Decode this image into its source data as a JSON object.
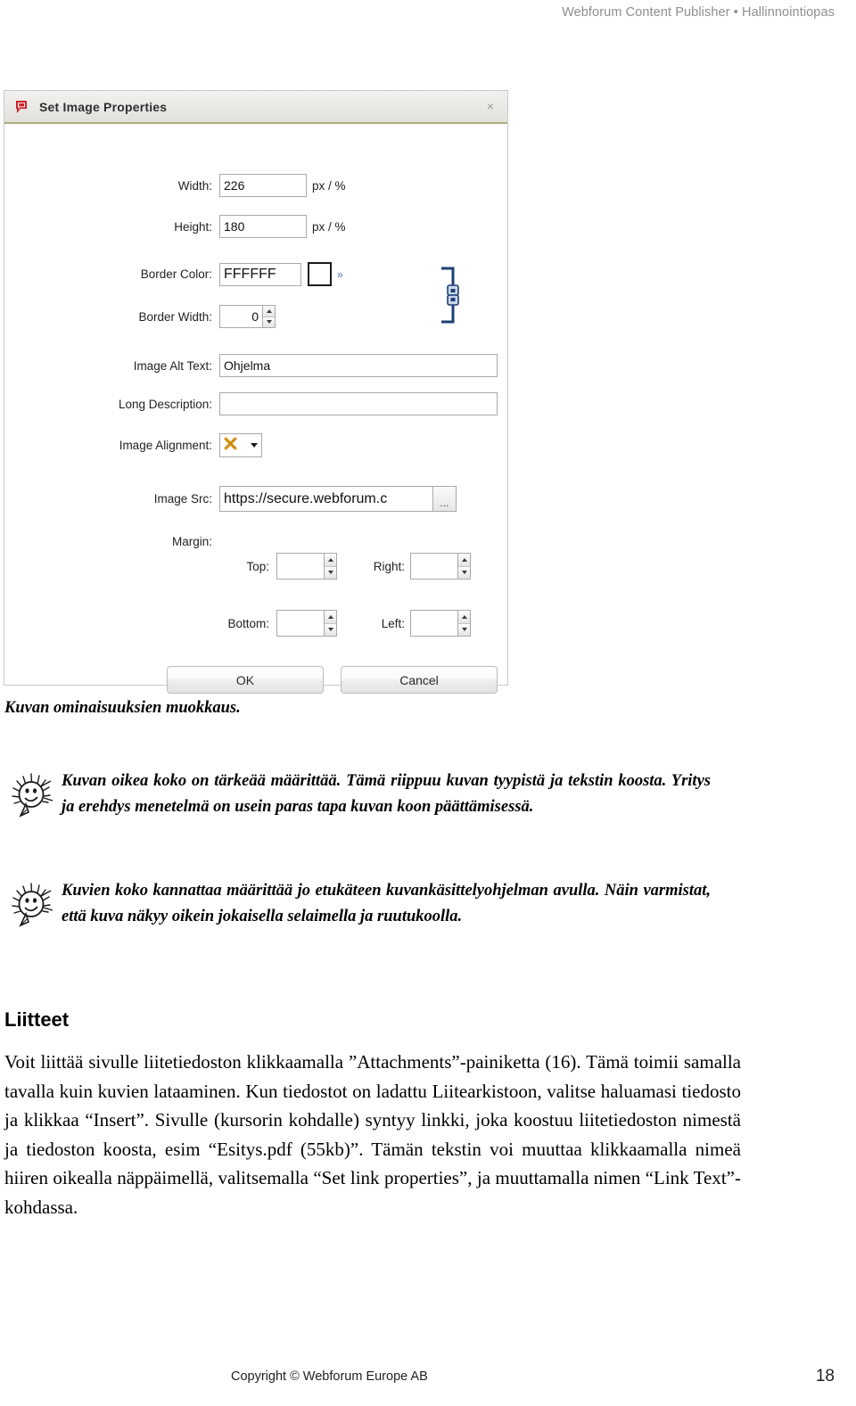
{
  "header": {
    "running_head": "Webforum Content Publisher • Hallinnointiopas"
  },
  "dialog": {
    "title": "Set Image Properties",
    "app_icon": "webforum-logo-icon",
    "close_label": "×",
    "constrain_icon": "constrain-proportions-chain-icon",
    "fields": {
      "width": {
        "label": "Width:",
        "value": "226",
        "suffix": "px / %"
      },
      "height": {
        "label": "Height:",
        "value": "180",
        "suffix": "px / %"
      },
      "border_color": {
        "label": "Border Color:",
        "value": "FFFFFF",
        "swatch": "#FFFFFF",
        "more_label": "»"
      },
      "border_width": {
        "label": "Border Width:",
        "value": "0"
      },
      "image_alt_text": {
        "label": "Image Alt Text:",
        "value": "Ohjelma"
      },
      "long_description": {
        "label": "Long Description:",
        "value": ""
      },
      "image_alignment": {
        "label": "Image Alignment:",
        "value": "",
        "icon": "orange-x-icon"
      },
      "image_src": {
        "label": "Image Src:",
        "value": "https://secure.webforum.c",
        "browse_label": "..."
      },
      "margin": {
        "label": "Margin:",
        "top": {
          "label": "Top:",
          "value": ""
        },
        "right": {
          "label": "Right:",
          "value": ""
        },
        "bottom": {
          "label": "Bottom:",
          "value": ""
        },
        "left": {
          "label": "Left:",
          "value": ""
        }
      }
    },
    "buttons": {
      "ok": "OK",
      "cancel": "Cancel"
    }
  },
  "content": {
    "figure_caption": "Kuvan ominaisuuksien muokkaus.",
    "tips": [
      {
        "icon": "lightbulb-tip-icon",
        "text": "Kuvan oikea koko on tärkeää määrittää. Tämä riippuu kuvan tyypistä ja tekstin koosta. Yritys ja erehdys menetelmä on usein paras tapa kuvan koon päättämisessä."
      },
      {
        "icon": "lightbulb-tip-icon",
        "text": "Kuvien koko kannattaa määrittää jo etukäteen kuvankäsittelyohjelman avulla. Näin varmistat, että kuva näkyy oikein jokaisella selaimella ja ruutukoolla."
      }
    ],
    "section_heading": "Liitteet",
    "paragraph": "Voit liittää sivulle liitetiedoston klikkaamalla ”Attachments”-painiketta (16). Tämä toimii samalla tavalla kuin kuvien lataaminen. Kun tiedostot on ladattu Liitearkistoon, valitse haluamasi tiedosto ja klikkaa “Insert”. Sivulle (kursorin kohdalle) syntyy linkki, joka koostuu liitetiedoston nimestä ja tiedoston koosta, esim “Esitys.pdf (55kb)”. Tämän tekstin voi muuttaa klikkaamalla nimeä hiiren oikealla näppäimellä, valitsemalla “Set link properties”, ja muuttamalla nimen “Link Text”-kohdassa."
  },
  "footer": {
    "copyright": "Copyright © Webforum Europe AB",
    "page_number": "18"
  }
}
